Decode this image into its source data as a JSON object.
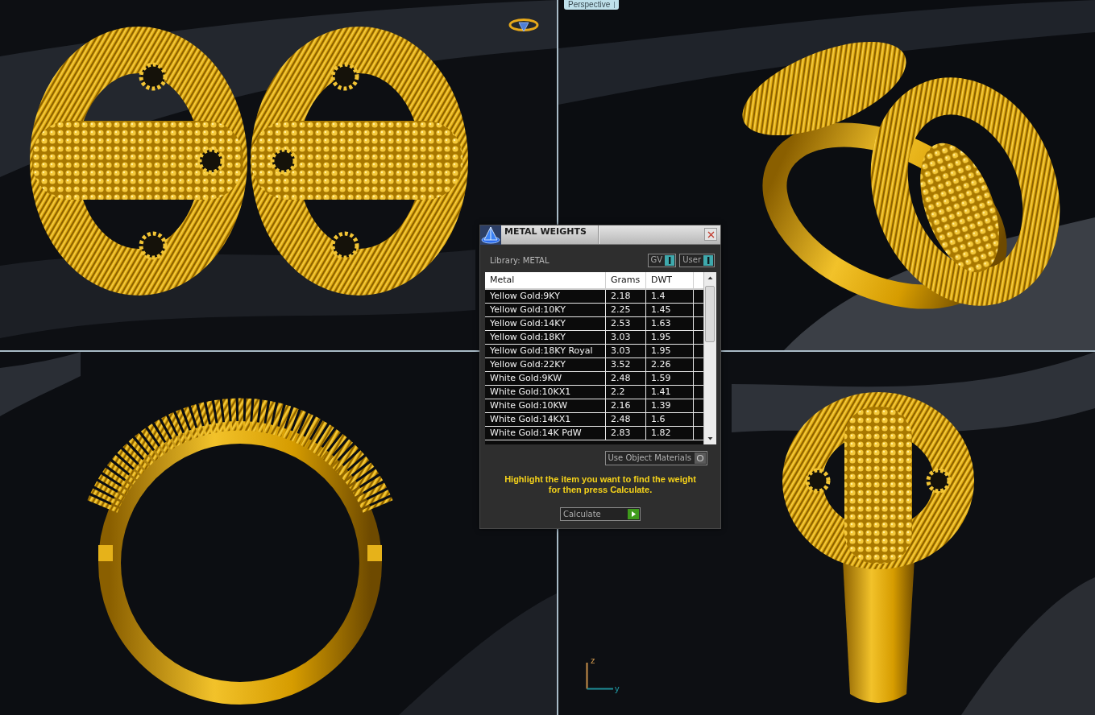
{
  "viewport_label": "Perspective",
  "axis_indicator": {
    "vertical_label": "z",
    "horizontal_label": "y"
  },
  "dialog": {
    "title": "METAL WEIGHTS",
    "library": "Library: METAL",
    "toggles": [
      {
        "label": "GV",
        "on": true
      },
      {
        "label": "User",
        "on": true
      }
    ],
    "table": {
      "columns": [
        "Metal",
        "Grams",
        "DWT"
      ],
      "rows": [
        [
          "Yellow Gold:9KY",
          "2.18",
          "1.4"
        ],
        [
          "Yellow Gold:10KY",
          "2.25",
          "1.45"
        ],
        [
          "Yellow Gold:14KY",
          "2.53",
          "1.63"
        ],
        [
          "Yellow Gold:18KY",
          "3.03",
          "1.95"
        ],
        [
          "Yellow Gold:18KY Royal",
          "3.03",
          "1.95"
        ],
        [
          "Yellow Gold:22KY",
          "3.52",
          "2.26"
        ],
        [
          "White Gold:9KW",
          "2.48",
          "1.59"
        ],
        [
          "White Gold:10KX1",
          "2.2",
          "1.41"
        ],
        [
          "White Gold:10KW",
          "2.16",
          "1.39"
        ],
        [
          "White Gold:14KX1",
          "2.48",
          "1.6"
        ],
        [
          "White Gold:14K PdW",
          "2.83",
          "1.82"
        ]
      ]
    },
    "use_object_materials": "Use Object Materials",
    "instruction": "Highlight the item you want to find the weight for then press Calculate.",
    "calculate_button": "Calculate"
  }
}
